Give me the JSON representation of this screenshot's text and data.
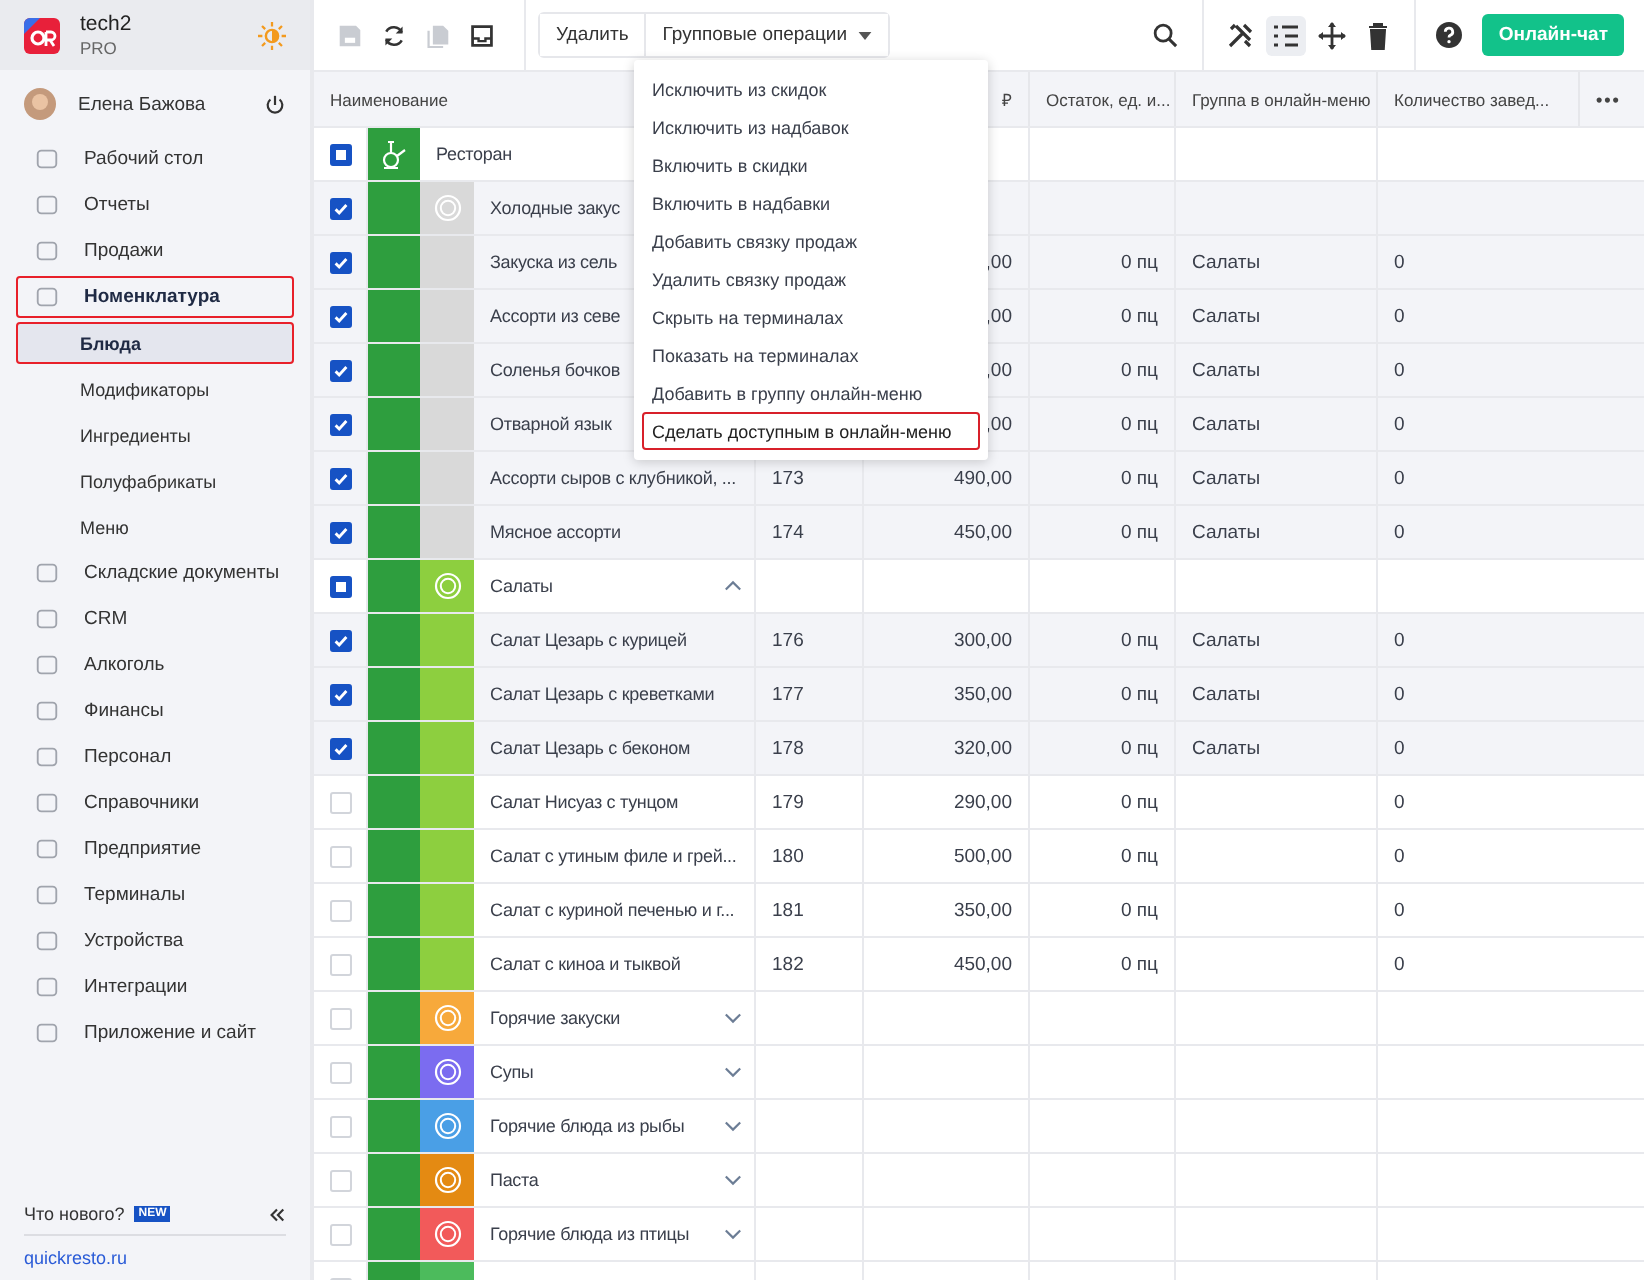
{
  "sidebar": {
    "brand": {
      "name": "tech2",
      "plan": "PRO"
    },
    "user": {
      "name": "Елена Бажова"
    },
    "items": [
      {
        "label": "Рабочий стол",
        "highlighted": false,
        "selected": false
      },
      {
        "label": "Отчеты",
        "highlighted": false,
        "selected": false
      },
      {
        "label": "Продажи",
        "highlighted": false,
        "selected": false
      },
      {
        "label": "Номенклатура",
        "highlighted": true,
        "selected": false,
        "children": [
          {
            "label": "Блюда",
            "highlighted": true,
            "selected": true
          },
          {
            "label": "Модификаторы",
            "highlighted": false,
            "selected": false
          },
          {
            "label": "Ингредиенты",
            "highlighted": false,
            "selected": false
          },
          {
            "label": "Полуфабрикаты",
            "highlighted": false,
            "selected": false
          },
          {
            "label": "Меню",
            "highlighted": false,
            "selected": false
          }
        ]
      },
      {
        "label": "Складские документы",
        "highlighted": false,
        "selected": false
      },
      {
        "label": "CRM",
        "highlighted": false,
        "selected": false
      },
      {
        "label": "Алкоголь",
        "highlighted": false,
        "selected": false
      },
      {
        "label": "Финансы",
        "highlighted": false,
        "selected": false
      },
      {
        "label": "Персонал",
        "highlighted": false,
        "selected": false
      },
      {
        "label": "Справочники",
        "highlighted": false,
        "selected": false
      },
      {
        "label": "Предприятие",
        "highlighted": false,
        "selected": false
      },
      {
        "label": "Терминалы",
        "highlighted": false,
        "selected": false
      },
      {
        "label": "Устройства",
        "highlighted": false,
        "selected": false
      },
      {
        "label": "Интеграции",
        "highlighted": false,
        "selected": false
      },
      {
        "label": "Приложение и сайт",
        "highlighted": false,
        "selected": false
      }
    ],
    "whats_new": {
      "label": "Что нового?",
      "badge": "NEW"
    },
    "link": "quickresto.ru"
  },
  "toolbar": {
    "left_icons": [
      {
        "kind": "save",
        "disabled": true
      },
      {
        "kind": "refresh",
        "disabled": false
      },
      {
        "kind": "copy",
        "disabled": true
      },
      {
        "kind": "inbox",
        "disabled": false
      }
    ],
    "delete_button": "Удалить",
    "group_ops_button": "Групповые операции",
    "right_icons": [
      {
        "kind": "tools",
        "selected": false
      },
      {
        "kind": "list",
        "selected": true
      },
      {
        "kind": "move",
        "selected": false
      },
      {
        "kind": "trash",
        "selected": false
      }
    ],
    "chat_button": "Онлайн-чат"
  },
  "dropdown": {
    "items": [
      {
        "label": "Исключить из скидок",
        "highlighted": false
      },
      {
        "label": "Исключить из надбавок",
        "highlighted": false
      },
      {
        "label": "Включить в скидки",
        "highlighted": false
      },
      {
        "label": "Включить в надбавки",
        "highlighted": false
      },
      {
        "label": "Добавить связку продаж",
        "highlighted": false
      },
      {
        "label": "Удалить связку продаж",
        "highlighted": false
      },
      {
        "label": "Скрыть на терминалах",
        "highlighted": false
      },
      {
        "label": "Показать на терминалах",
        "highlighted": false
      },
      {
        "label": "Добавить в группу онлайн-меню",
        "highlighted": false
      },
      {
        "label": "Сделать доступным в онлайн-меню",
        "highlighted": true
      }
    ]
  },
  "table": {
    "columns": [
      "Наименование",
      "",
      "₽",
      "Остаток, ед. и...",
      "Группа в онлайн-меню",
      "Количество завед..."
    ],
    "more": "•••",
    "root": {
      "name": "Ресторан",
      "partial": true,
      "children": [
        {
          "name": "Холодные закус",
          "color": "#d9d9d9",
          "checked": true,
          "children": [
            {
              "name": "Закуска из сель",
              "price": ",00",
              "stock": "0 пц",
              "online_group": "Салаты",
              "count": "0",
              "checked": true
            },
            {
              "name": "Ассорти из севе",
              "price": ",00",
              "stock": "0 пц",
              "online_group": "Салаты",
              "count": "0",
              "checked": true
            },
            {
              "name": "Соленья бочков",
              "price": ",00",
              "stock": "0 пц",
              "online_group": "Салаты",
              "count": "0",
              "checked": true
            },
            {
              "name": "Отварной язык",
              "price": ",00",
              "stock": "0 пц",
              "online_group": "Салаты",
              "count": "0",
              "checked": true
            },
            {
              "name": "Ассорти сыров с клубникой, ...",
              "code": "173",
              "price": "490,00",
              "stock": "0 пц",
              "online_group": "Салаты",
              "count": "0",
              "checked": true
            },
            {
              "name": "Мясное ассорти",
              "code": "174",
              "price": "450,00",
              "stock": "0 пц",
              "online_group": "Салаты",
              "count": "0",
              "checked": true
            }
          ]
        },
        {
          "name": "Салаты",
          "color": "#8dcf3f",
          "partial": true,
          "expanded": true,
          "children": [
            {
              "name": "Салат Цезарь с курицей",
              "code": "176",
              "price": "300,00",
              "stock": "0 пц",
              "online_group": "Салаты",
              "count": "0",
              "checked": true
            },
            {
              "name": "Салат Цезарь с креветками",
              "code": "177",
              "price": "350,00",
              "stock": "0 пц",
              "online_group": "Салаты",
              "count": "0",
              "checked": true
            },
            {
              "name": "Салат Цезарь с беконом",
              "code": "178",
              "price": "320,00",
              "stock": "0 пц",
              "online_group": "Салаты",
              "count": "0",
              "checked": true
            },
            {
              "name": "Салат Нисуаз с тунцом",
              "code": "179",
              "price": "290,00",
              "stock": "0 пц",
              "count": "0",
              "checked": false
            },
            {
              "name": "Салат с утиным филе и грей...",
              "code": "180",
              "price": "500,00",
              "stock": "0 пц",
              "count": "0",
              "checked": false
            },
            {
              "name": "Салат с куриной печенью и г...",
              "code": "181",
              "price": "350,00",
              "stock": "0 пц",
              "count": "0",
              "checked": false
            },
            {
              "name": "Салат с киноа и тыквой",
              "code": "182",
              "price": "450,00",
              "stock": "0 пц",
              "count": "0",
              "checked": false
            }
          ]
        },
        {
          "name": "Горячие закуски",
          "color": "#f7a93b",
          "checked": false,
          "expanded": false
        },
        {
          "name": "Супы",
          "color": "#7b6cf0",
          "checked": false,
          "expanded": false
        },
        {
          "name": "Горячие блюда из рыбы",
          "color": "#4a9fe6",
          "checked": false,
          "expanded": false
        },
        {
          "name": "Паста",
          "color": "#e48a12",
          "checked": false,
          "expanded": false
        },
        {
          "name": "Горячие блюда из птицы",
          "color": "#f25a5a",
          "checked": false,
          "expanded": false
        },
        {
          "color": "#4cbb5c",
          "checked": false
        }
      ]
    }
  }
}
